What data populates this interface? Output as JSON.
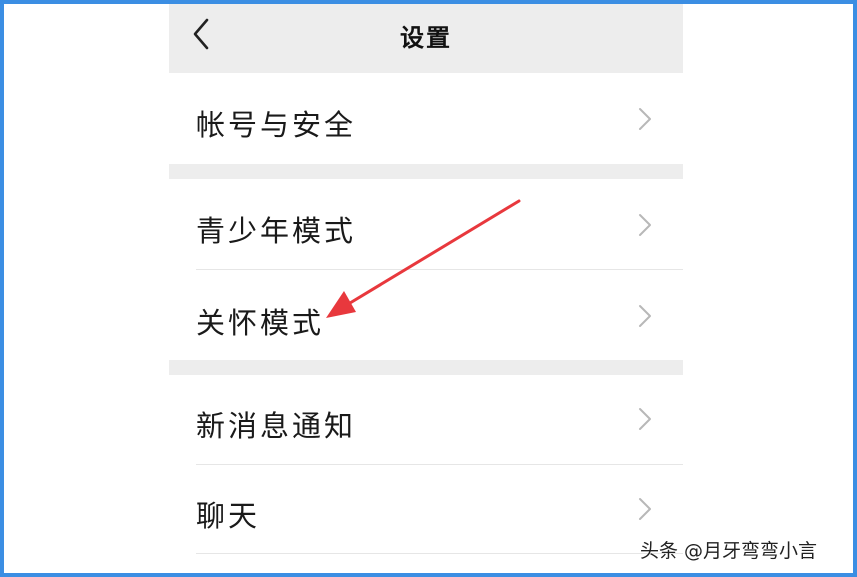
{
  "header": {
    "title": "设置",
    "back_icon": "chevron-left-icon"
  },
  "settings": {
    "items": [
      {
        "label": "帐号与安全",
        "icon": "chevron-right-icon"
      },
      {
        "label": "青少年模式",
        "icon": "chevron-right-icon"
      },
      {
        "label": "关怀模式",
        "icon": "chevron-right-icon"
      },
      {
        "label": "新消息通知",
        "icon": "chevron-right-icon"
      },
      {
        "label": "聊天",
        "icon": "chevron-right-icon"
      }
    ]
  },
  "annotation": {
    "arrow_color": "#e8383d"
  },
  "watermark": {
    "text": "头条 @月牙弯弯小言"
  },
  "colors": {
    "frame": "#3b8ee3",
    "header_bg": "#ededed",
    "gap_bg": "#ededed"
  }
}
